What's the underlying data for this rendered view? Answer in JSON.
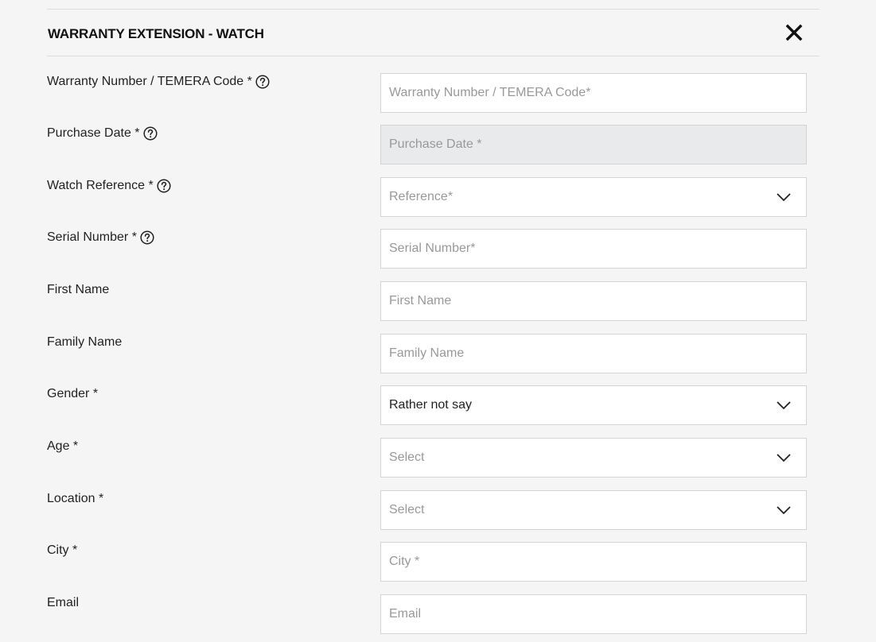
{
  "header": {
    "title": "WARRANTY EXTENSION - WATCH"
  },
  "form": {
    "warranty_number": {
      "label": "Warranty Number / TEMERA Code *",
      "placeholder": "Warranty Number / TEMERA Code*"
    },
    "purchase_date": {
      "label": "Purchase Date *",
      "placeholder": "Purchase Date *"
    },
    "watch_reference": {
      "label": "Watch Reference *",
      "value": "Reference*"
    },
    "serial_number": {
      "label": "Serial Number *",
      "placeholder": "Serial Number*"
    },
    "first_name": {
      "label": "First Name",
      "placeholder": "First Name"
    },
    "family_name": {
      "label": "Family Name",
      "placeholder": "Family Name"
    },
    "gender": {
      "label": "Gender *",
      "value": "Rather not say"
    },
    "age": {
      "label": "Age *",
      "value": "Select"
    },
    "location": {
      "label": "Location *",
      "value": "Select"
    },
    "city": {
      "label": "City *",
      "placeholder": "City *"
    },
    "email": {
      "label": "Email",
      "placeholder": "Email"
    }
  }
}
